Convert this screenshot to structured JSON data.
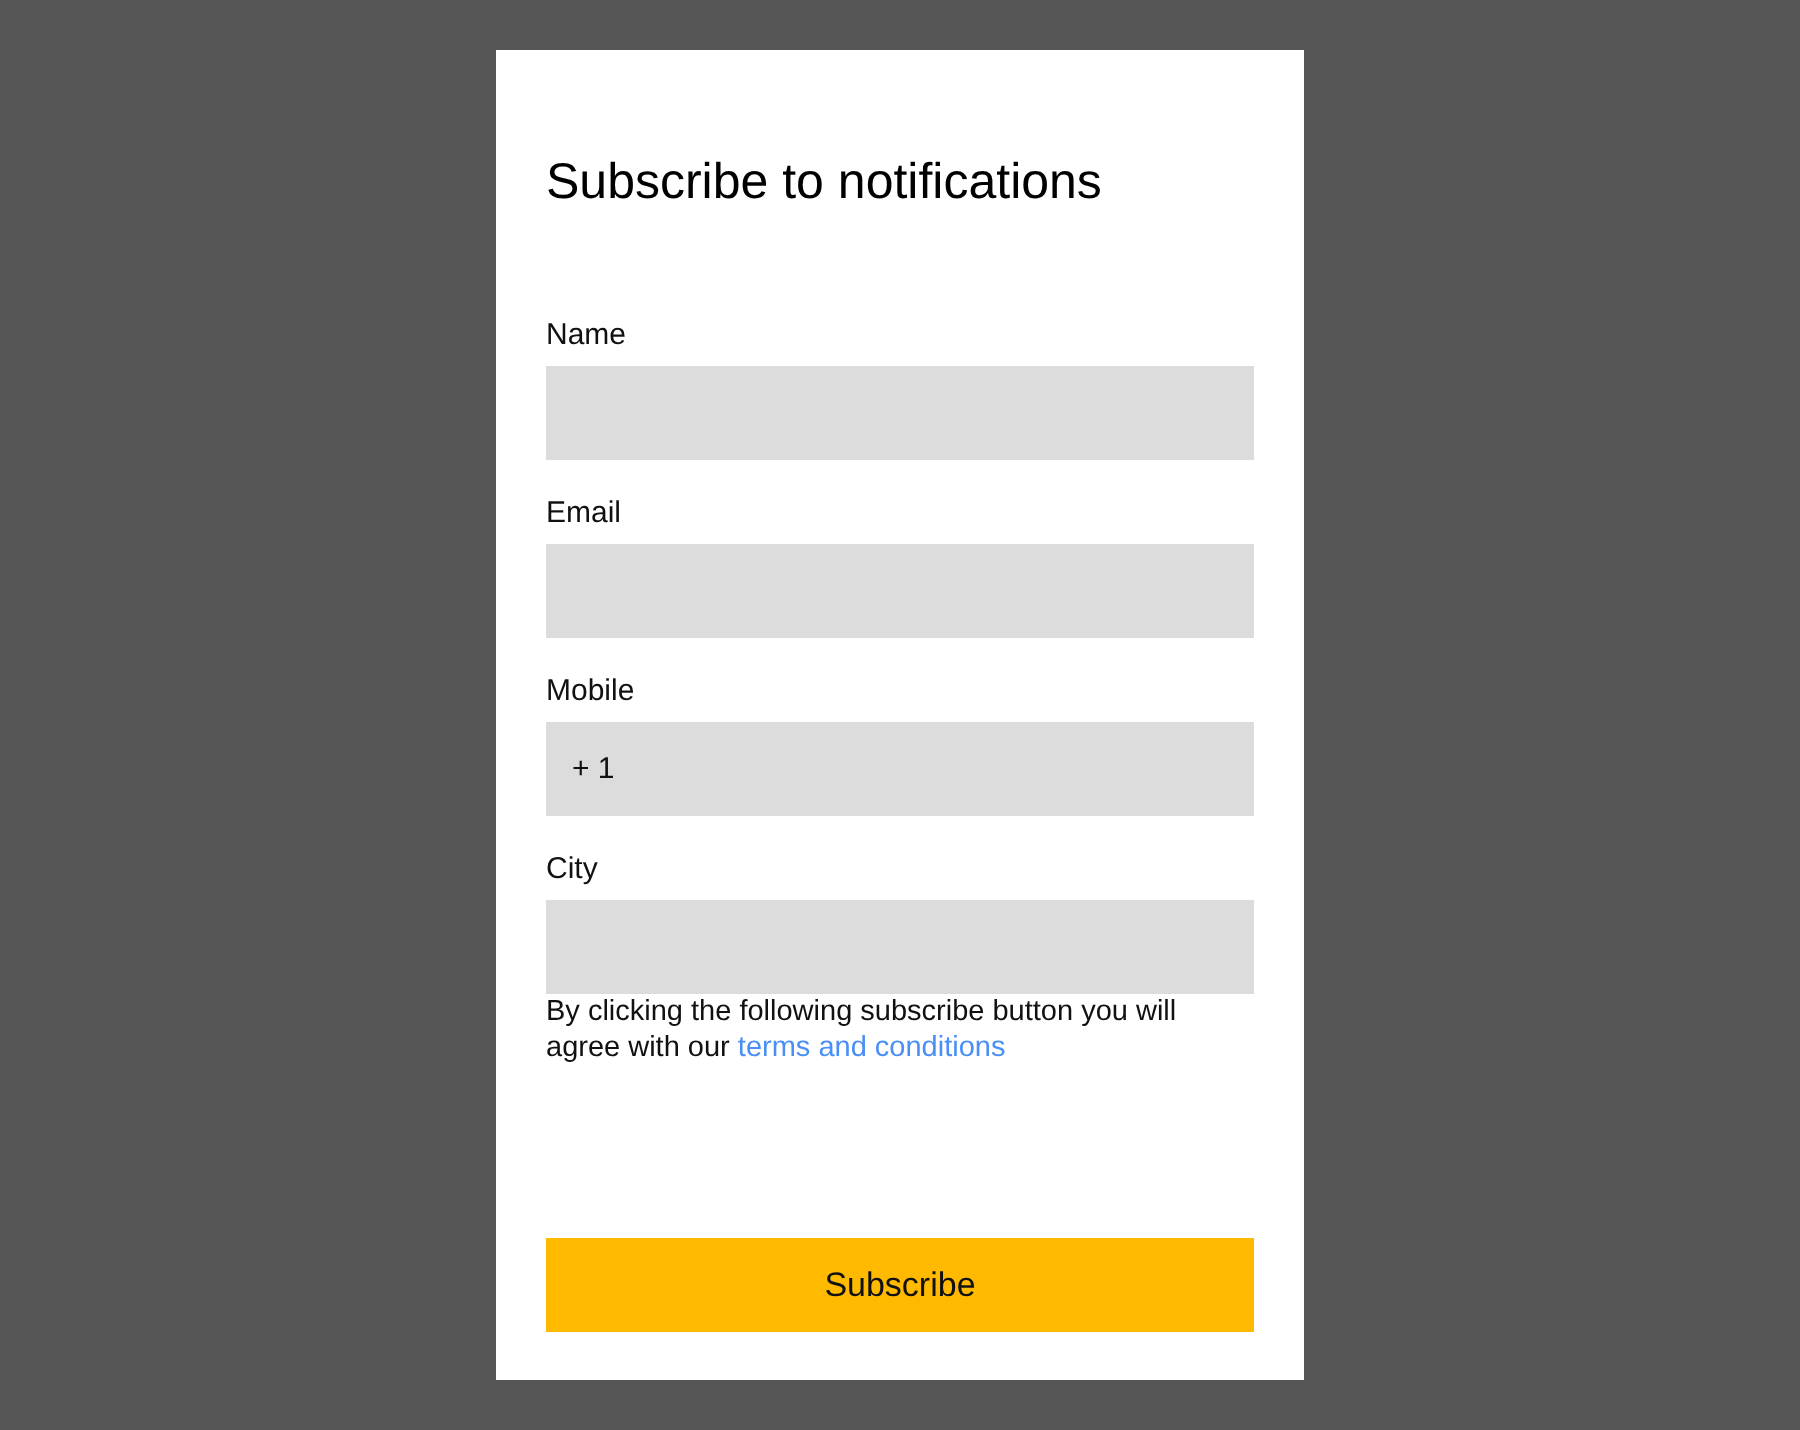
{
  "title": "Subscribe to notifications",
  "fields": [
    {
      "label": "Name"
    },
    {
      "label": "Email"
    },
    {
      "label": "Mobile",
      "value": "+ 1"
    },
    {
      "label": "City"
    }
  ],
  "notice": {
    "text": "By clicking the following subscribe button you will agree with our ",
    "link": "terms and conditions"
  },
  "button": "Subscribe"
}
